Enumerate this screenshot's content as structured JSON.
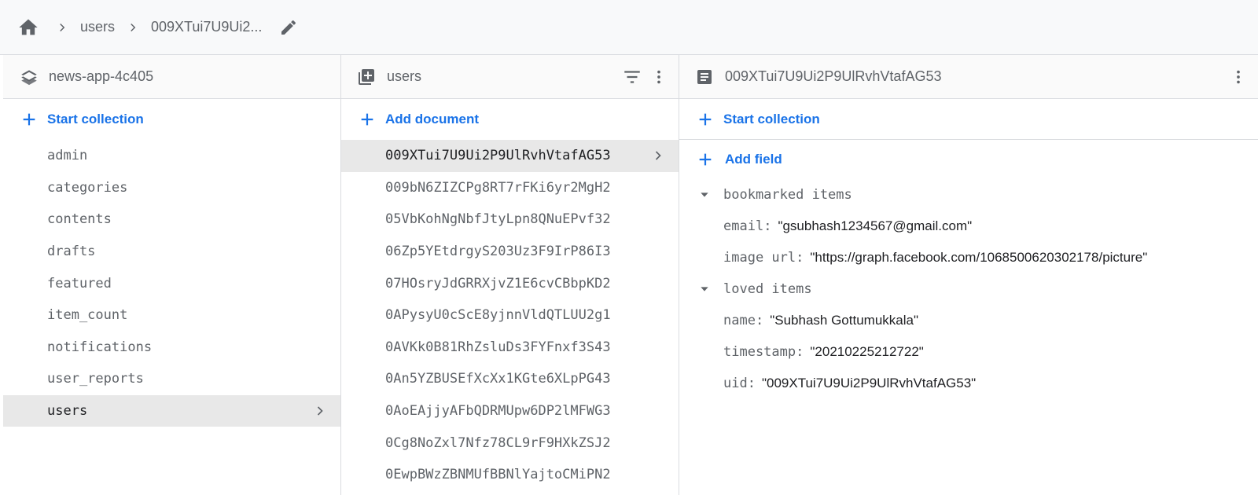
{
  "breadcrumb": {
    "items": [
      "users",
      "009XTui7U9Ui2..."
    ]
  },
  "panel_project": {
    "title": "news-app-4c405",
    "action_label": "Start collection",
    "collections": [
      {
        "label": "admin"
      },
      {
        "label": "categories"
      },
      {
        "label": "contents"
      },
      {
        "label": "drafts"
      },
      {
        "label": "featured"
      },
      {
        "label": "item_count"
      },
      {
        "label": "notifications"
      },
      {
        "label": "user_reports"
      },
      {
        "label": "users"
      }
    ],
    "selected": "users"
  },
  "panel_collection": {
    "title": "users",
    "action_label": "Add document",
    "documents": [
      {
        "id": "009XTui7U9Ui2P9UlRvhVtafAG53"
      },
      {
        "id": "009bN6ZIZCPg8RT7rFKi6yr2MgH2"
      },
      {
        "id": "05VbKohNgNbfJtyLpn8QNuEPvf32"
      },
      {
        "id": "06Zp5YEtdrgyS203Uz3F9IrP86I3"
      },
      {
        "id": "07HOsryJdGRRXjvZ1E6cvCBbpKD2"
      },
      {
        "id": "0APysyU0cScE8yjnnVldQTLUU2g1"
      },
      {
        "id": "0AVKk0B81RhZsluDs3FYFnxf3S43"
      },
      {
        "id": "0An5YZBUSEfXcXx1KGte6XLpPG43"
      },
      {
        "id": "0AoEAjjyAFbQDRMUpw6DP2lMFWG3"
      },
      {
        "id": "0Cg8NoZxl7Nfz78CL9rF9HXkZSJ2"
      },
      {
        "id": "0EwpBWzZBNMUfBBNlYajtoCMiPN2"
      }
    ],
    "selected": "009XTui7U9Ui2P9UlRvhVtafAG53"
  },
  "panel_document": {
    "title": "009XTui7U9Ui2P9UlRvhVtafAG53",
    "action_label": "Start collection",
    "add_field_label": "Add field",
    "fields": [
      {
        "kind": "group",
        "key": "bookmarked items"
      },
      {
        "kind": "field",
        "key": "email",
        "value": "\"gsubhash1234567@gmail.com\""
      },
      {
        "kind": "field",
        "key": "image url",
        "value": "\"https://graph.facebook.com/1068500620302178/picture\""
      },
      {
        "kind": "group",
        "key": "loved items"
      },
      {
        "kind": "field",
        "key": "name",
        "value": "\"Subhash Gottumukkala\""
      },
      {
        "kind": "field",
        "key": "timestamp",
        "value": "\"20210225212722\""
      },
      {
        "kind": "field",
        "key": "uid",
        "value": "\"009XTui7U9Ui2P9UlRvhVtafAG53\""
      }
    ]
  },
  "colors": {
    "accent": "#1a73e8",
    "icon": "#5f6368",
    "selected_row": "#e8e8e8"
  },
  "icons": {
    "home": "home-icon",
    "chevron": "chevron-right-icon",
    "edit": "pencil-icon",
    "project": "stack-icon",
    "collection": "collection-icon",
    "document": "document-icon",
    "filter": "filter-icon",
    "menu": "more-vert-icon",
    "add": "plus-icon",
    "expand": "caret-down-icon"
  }
}
